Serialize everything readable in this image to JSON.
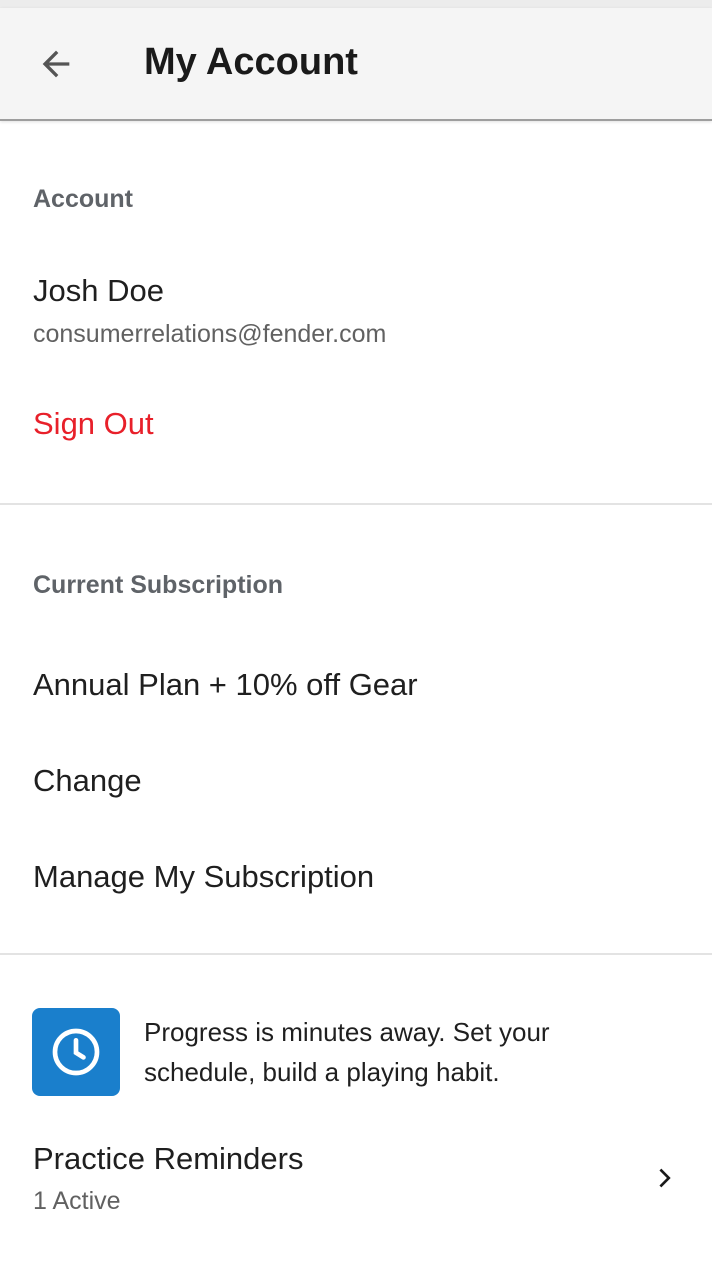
{
  "header": {
    "title": "My Account",
    "back_icon": "arrow-left-icon"
  },
  "account": {
    "section_label": "Account",
    "name": "Josh Doe",
    "email": "consumerrelations@fender.com",
    "sign_out_label": "Sign Out",
    "sign_out_color": "#e8202a"
  },
  "subscription": {
    "section_label": "Current Subscription",
    "plan_name": "Annual Plan + 10% off Gear",
    "change_label": "Change",
    "manage_label": "Manage My Subscription"
  },
  "practice": {
    "icon": "clock-icon",
    "icon_bg_color": "#1a7fcc",
    "promo_text": "Progress is minutes away. Set your schedule, build a playing habit.",
    "reminders_label": "Practice Reminders",
    "reminders_status": "1 Active",
    "chevron_icon": "chevron-right-icon"
  }
}
